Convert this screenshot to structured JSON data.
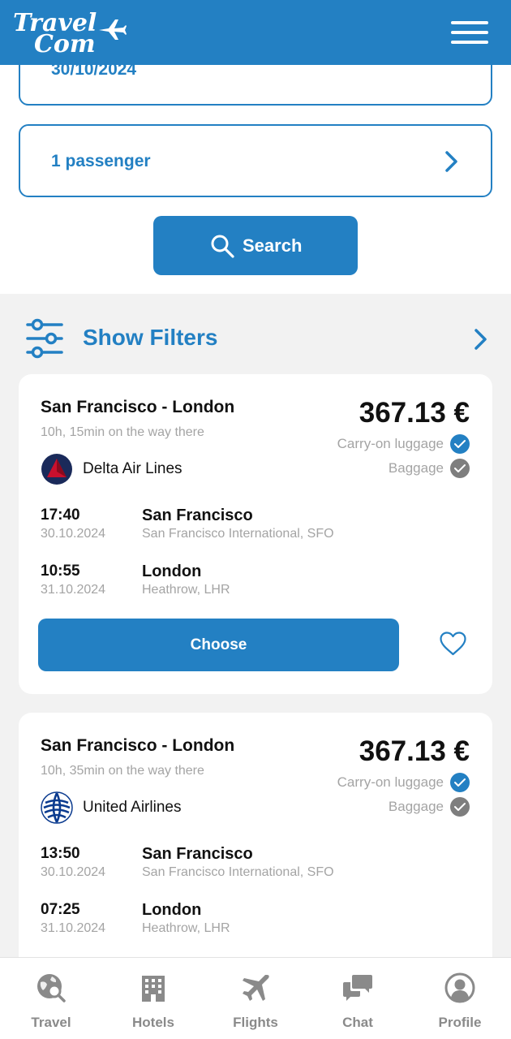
{
  "header": {
    "logo_line1": "Travel",
    "logo_line2": "Com"
  },
  "search": {
    "date_value": "30/10/2024",
    "passengers": "1 passenger",
    "search_label": "Search"
  },
  "filters": {
    "label": "Show Filters"
  },
  "colors": {
    "accent": "#2380c3",
    "muted": "#a4a4a4",
    "background": "#f2f2f2"
  },
  "results": [
    {
      "route": "San Francisco - London",
      "duration": "10h, 15min on the way there",
      "airline": "Delta Air Lines",
      "airline_icon": "delta-logo",
      "price": "367.13 €",
      "carry_on": "Carry-on luggage",
      "baggage": "Baggage",
      "departure": {
        "time": "17:40",
        "date": "30.10.2024",
        "city": "San Francisco",
        "airport": "San Francisco International, SFO"
      },
      "arrival": {
        "time": "10:55",
        "date": "31.10.2024",
        "city": "London",
        "airport": "Heathrow, LHR"
      },
      "choose_label": "Choose"
    },
    {
      "route": "San Francisco - London",
      "duration": "10h, 35min on the way there",
      "airline": "United Airlines",
      "airline_icon": "united-logo",
      "price": "367.13 €",
      "carry_on": "Carry-on luggage",
      "baggage": "Baggage",
      "departure": {
        "time": "13:50",
        "date": "30.10.2024",
        "city": "San Francisco",
        "airport": "San Francisco International, SFO"
      },
      "arrival": {
        "time": "07:25",
        "date": "31.10.2024",
        "city": "London",
        "airport": "Heathrow, LHR"
      }
    }
  ],
  "tabbar": [
    {
      "label": "Travel",
      "icon": "globe-search-icon"
    },
    {
      "label": "Hotels",
      "icon": "hotel-building-icon"
    },
    {
      "label": "Flights",
      "icon": "airplane-icon"
    },
    {
      "label": "Chat",
      "icon": "chat-bubbles-icon"
    },
    {
      "label": "Profile",
      "icon": "user-circle-icon"
    }
  ]
}
